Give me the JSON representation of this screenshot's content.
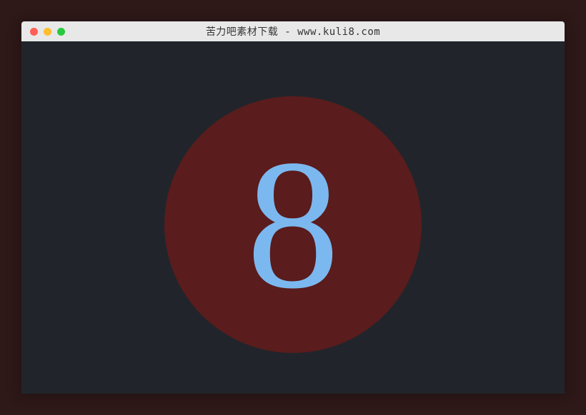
{
  "window": {
    "title": "苦力吧素材下载 - www.kuli8.com"
  },
  "countdown": {
    "value": "8"
  },
  "colors": {
    "circle_bg": "#5a1c1c",
    "number": "#7cb8f0",
    "content_bg": "#21252b",
    "page_bg": "#2e1818"
  }
}
